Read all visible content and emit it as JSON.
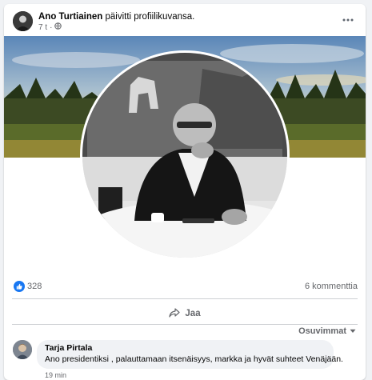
{
  "post": {
    "author": "Ano Turtiainen",
    "action": "päivitti profiilikuvansa.",
    "time": "7 t",
    "privacy_icon": "globe-icon",
    "more_icon": "more-dots-icon"
  },
  "stats": {
    "reactions_count": "328",
    "comments_count": "6 kommenttia"
  },
  "actions": {
    "share_label": "Jaa",
    "share_icon": "share-arrow-icon"
  },
  "comments": {
    "sort_label": "Osuvimmat",
    "items": [
      {
        "author": "Tarja Pirtala",
        "text": "Ano presidentiksi , palauttamaan itsenäisyys, markka ja hyvät suhteet Venäjään.",
        "time": "19 min"
      }
    ]
  },
  "colors": {
    "accent": "#1877f2",
    "secondary_text": "#65676b",
    "background": "#f0f2f5"
  }
}
